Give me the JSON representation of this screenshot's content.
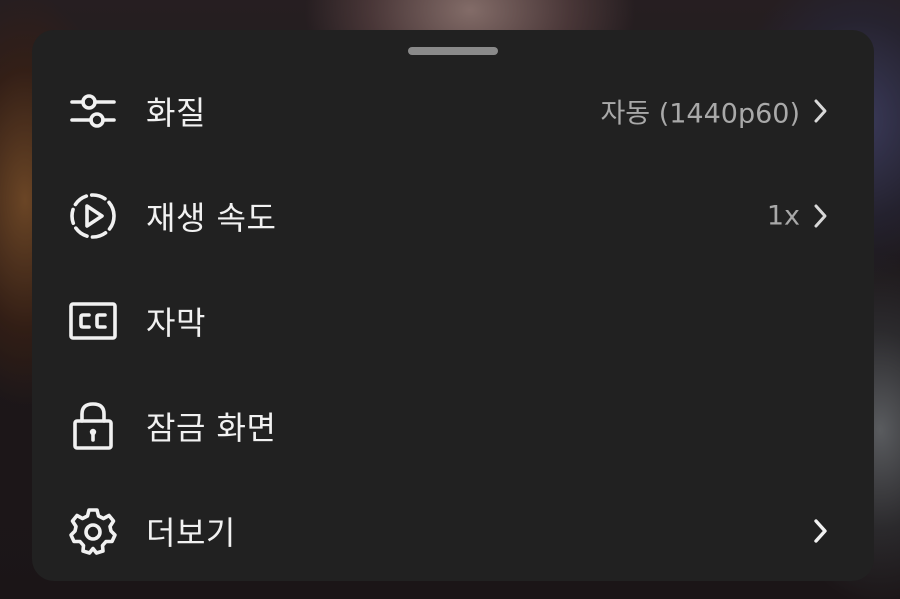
{
  "menu": {
    "items": [
      {
        "icon": "sliders-icon",
        "label": "화질",
        "value": "자동 (1440p60)",
        "has_chevron": true
      },
      {
        "icon": "playback-speed-icon",
        "label": "재생 속도",
        "value": "1x",
        "has_chevron": true
      },
      {
        "icon": "captions-icon",
        "label": "자막",
        "value": "",
        "has_chevron": false
      },
      {
        "icon": "lock-icon",
        "label": "잠금 화면",
        "value": "",
        "has_chevron": false
      },
      {
        "icon": "gear-icon",
        "label": "더보기",
        "value": "",
        "has_chevron": true
      }
    ]
  },
  "colors": {
    "sheet_background": "#212121",
    "label_text": "#f1f1f1",
    "value_text": "#a9a9a9",
    "handle": "#8a8a8a"
  }
}
